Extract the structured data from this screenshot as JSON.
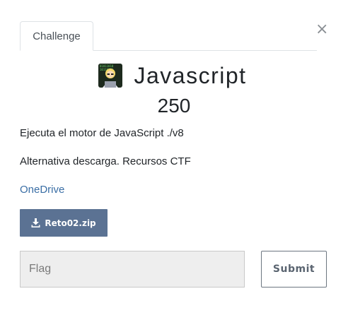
{
  "tabs": [
    {
      "label": "Challenge",
      "active": true
    }
  ],
  "close_label": "×",
  "challenge": {
    "name": "Javascript",
    "value": "250",
    "avatar_icon": "hacker-avatar-icon",
    "description_line_1": "Ejecuta el motor de JavaScript ./v8",
    "description_line_2": "Alternativa descarga. Recursos CTF",
    "link_text": "OneDrive"
  },
  "files": [
    {
      "label": "Reto02.zip",
      "icon": "download-icon"
    }
  ],
  "flag_form": {
    "placeholder": "Flag",
    "value": "",
    "submit_label": "Submit"
  },
  "colors": {
    "link": "#3a6ea5",
    "file_button_bg": "#5b7293",
    "input_bg": "#eeeeee"
  }
}
